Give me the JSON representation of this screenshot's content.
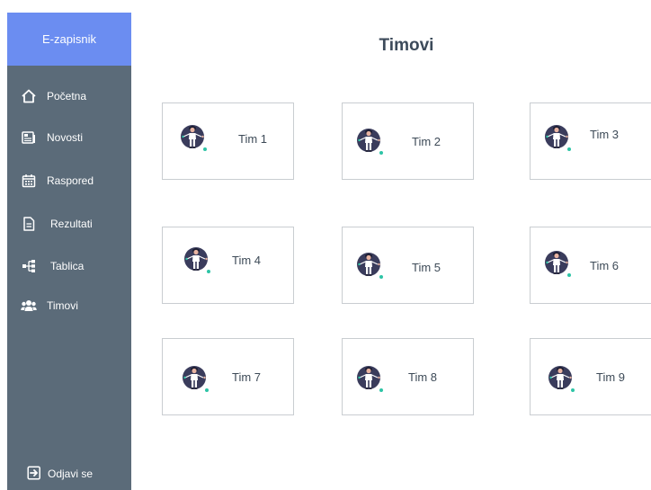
{
  "sidebar": {
    "brand": "E-zapisnik",
    "items": [
      {
        "label": "Početna",
        "icon": "home-icon"
      },
      {
        "label": "Novosti",
        "icon": "newspaper-icon"
      },
      {
        "label": "Raspored",
        "icon": "calendar-icon"
      },
      {
        "label": "Rezultati",
        "icon": "document-icon"
      },
      {
        "label": "Tablica",
        "icon": "sitemap-icon"
      },
      {
        "label": "Timovi",
        "icon": "users-icon"
      }
    ],
    "logout": {
      "label": "Odjavi se",
      "icon": "sign-out-icon"
    }
  },
  "main": {
    "title": "Timovi",
    "teams": [
      {
        "name": "Tim 1"
      },
      {
        "name": "Tim 2"
      },
      {
        "name": "Tim 3"
      },
      {
        "name": "Tim 4"
      },
      {
        "name": "Tim 5"
      },
      {
        "name": "Tim 6"
      },
      {
        "name": "Tim 7"
      },
      {
        "name": "Tim 8"
      },
      {
        "name": "Tim 9"
      }
    ]
  },
  "colors": {
    "sidebar": "#5b6b79",
    "brand": "#6b8df1",
    "avatar_dark": "#3a3c5c",
    "avatar_accent": "#2ec4a6"
  }
}
